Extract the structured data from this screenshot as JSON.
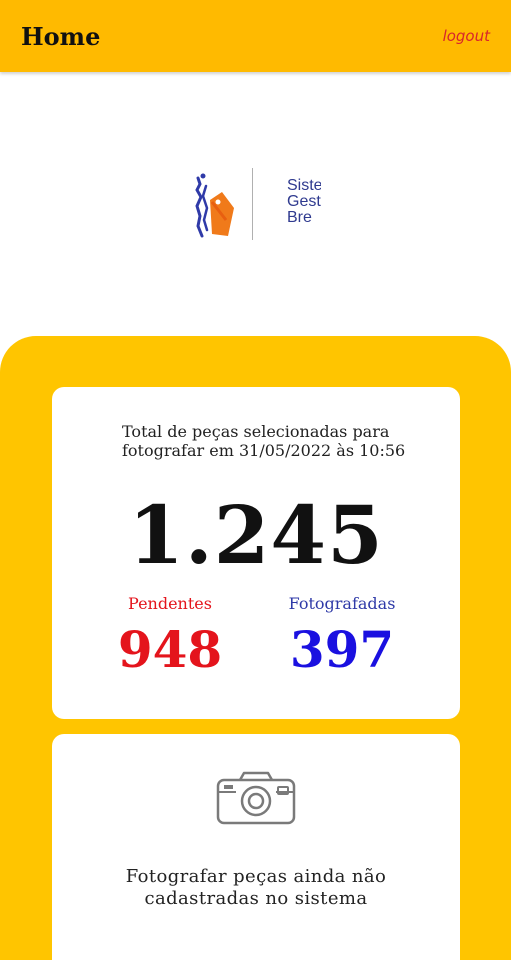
{
  "header": {
    "title": "Home",
    "logout_label": "logout"
  },
  "logo": {
    "text_lines": [
      "Siste",
      "Gest",
      "Bre"
    ]
  },
  "summary": {
    "caption": "Total de peças selecionadas para fotografar em 31/05/2022 às 10:56",
    "total": "1.245",
    "pending_label": "Pendentes",
    "pending_value": "948",
    "photographed_label": "Fotografadas",
    "photographed_value": "397"
  },
  "camera_card": {
    "icon": "camera-icon",
    "caption": "Fotografar peças ainda não cadastradas no sistema"
  },
  "colors": {
    "header_bg": "#ffba00",
    "panel_bg": "#ffc500",
    "pending": "#e4141c",
    "photographed": "#1a10e0",
    "logout": "#d8262b"
  }
}
